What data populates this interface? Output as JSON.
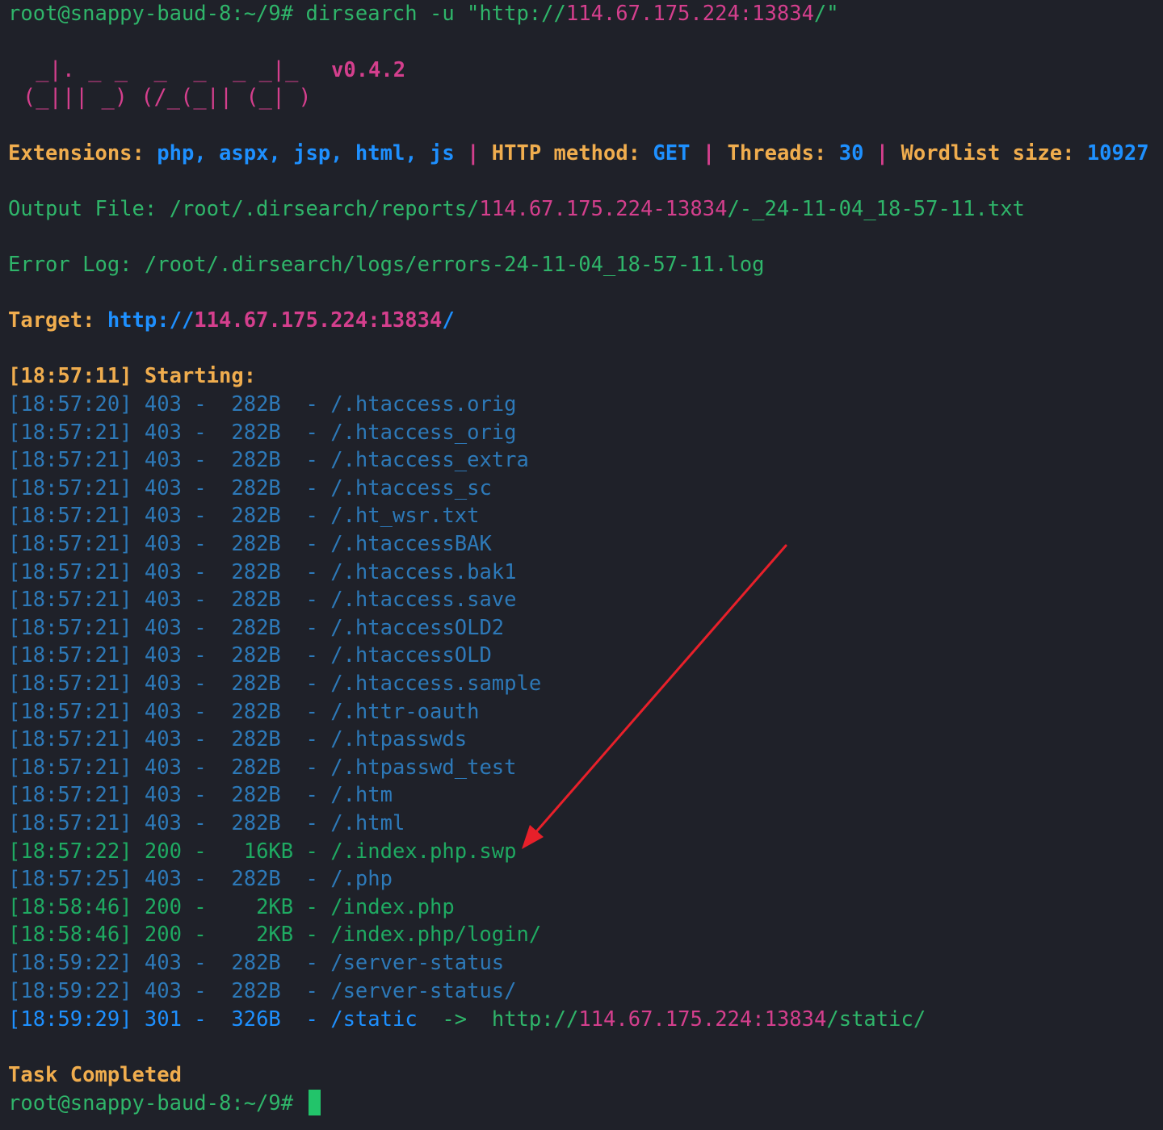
{
  "prompt": {
    "user_host": "root@snappy-baud-8:~/9#",
    "command_prefix": " dirsearch -u \"http://",
    "command_host": "114.67.175.224:13834",
    "command_suffix": "/\""
  },
  "banner": {
    "art_line1": " _|. _ _  _  _  _ _|_ ",
    "art_line2": "(_||| _) (/_(_|| (_| )",
    "version": "v0.4.2"
  },
  "config": {
    "extensions_label": "Extensions:",
    "extensions_value": "php, aspx, jsp, html, js",
    "sep": "|",
    "method_label": "HTTP method:",
    "method_value": "GET",
    "threads_label": "Threads:",
    "threads_value": "30",
    "wordlist_label": "Wordlist size:",
    "wordlist_value": "10927"
  },
  "output_file": {
    "label": "Output File:",
    "path_prefix": " /root/.dirsearch/reports/",
    "path_host": "114.67.175.224-13834",
    "path_suffix": "/-_24-11-04_18-57-11.txt"
  },
  "error_log": {
    "label": "Error Log:",
    "path": " /root/.dirsearch/logs/errors-24-11-04_18-57-11.log"
  },
  "target": {
    "label": "Target:",
    "scheme": "http://",
    "host": "114.67.175.224:13834",
    "slash": "/"
  },
  "starting": {
    "time": "[18:57:11]",
    "label": "Starting:"
  },
  "results": [
    {
      "time": "[18:57:20]",
      "code": "403",
      "size": "282B",
      "path": "/.htaccess.orig"
    },
    {
      "time": "[18:57:21]",
      "code": "403",
      "size": "282B",
      "path": "/.htaccess_orig"
    },
    {
      "time": "[18:57:21]",
      "code": "403",
      "size": "282B",
      "path": "/.htaccess_extra"
    },
    {
      "time": "[18:57:21]",
      "code": "403",
      "size": "282B",
      "path": "/.htaccess_sc"
    },
    {
      "time": "[18:57:21]",
      "code": "403",
      "size": "282B",
      "path": "/.ht_wsr.txt"
    },
    {
      "time": "[18:57:21]",
      "code": "403",
      "size": "282B",
      "path": "/.htaccessBAK"
    },
    {
      "time": "[18:57:21]",
      "code": "403",
      "size": "282B",
      "path": "/.htaccess.bak1"
    },
    {
      "time": "[18:57:21]",
      "code": "403",
      "size": "282B",
      "path": "/.htaccess.save"
    },
    {
      "time": "[18:57:21]",
      "code": "403",
      "size": "282B",
      "path": "/.htaccessOLD2"
    },
    {
      "time": "[18:57:21]",
      "code": "403",
      "size": "282B",
      "path": "/.htaccessOLD"
    },
    {
      "time": "[18:57:21]",
      "code": "403",
      "size": "282B",
      "path": "/.htaccess.sample"
    },
    {
      "time": "[18:57:21]",
      "code": "403",
      "size": "282B",
      "path": "/.httr-oauth"
    },
    {
      "time": "[18:57:21]",
      "code": "403",
      "size": "282B",
      "path": "/.htpasswds"
    },
    {
      "time": "[18:57:21]",
      "code": "403",
      "size": "282B",
      "path": "/.htpasswd_test"
    },
    {
      "time": "[18:57:21]",
      "code": "403",
      "size": "282B",
      "path": "/.htm"
    },
    {
      "time": "[18:57:21]",
      "code": "403",
      "size": "282B",
      "path": "/.html"
    },
    {
      "time": "[18:57:22]",
      "code": "200",
      "size": "16KB",
      "path": "/.index.php.swp"
    },
    {
      "time": "[18:57:25]",
      "code": "403",
      "size": "282B",
      "path": "/.php"
    },
    {
      "time": "[18:58:46]",
      "code": "200",
      "size": "2KB",
      "path": "/index.php"
    },
    {
      "time": "[18:58:46]",
      "code": "200",
      "size": "2KB",
      "path": "/index.php/login/"
    },
    {
      "time": "[18:59:22]",
      "code": "403",
      "size": "282B",
      "path": "/server-status"
    },
    {
      "time": "[18:59:22]",
      "code": "403",
      "size": "282B",
      "path": "/server-status/"
    }
  ],
  "redirect": {
    "time": "[18:59:29]",
    "code": "301",
    "size": "326B",
    "path": "/static",
    "arrow": "->",
    "scheme": "http://",
    "host": "114.67.175.224:13834",
    "suffix": "/static/"
  },
  "task_completed": "Task Completed",
  "final_prompt": "root@snappy-baud-8:~/9#",
  "colors": {
    "background": "#1f2129",
    "green": "#2fb56a",
    "pink": "#d43f8d",
    "orange": "#f0ad4e",
    "blue": "#1e90ff",
    "dim_blue": "#2d79b8",
    "annotation_arrow": "#e8202a"
  }
}
